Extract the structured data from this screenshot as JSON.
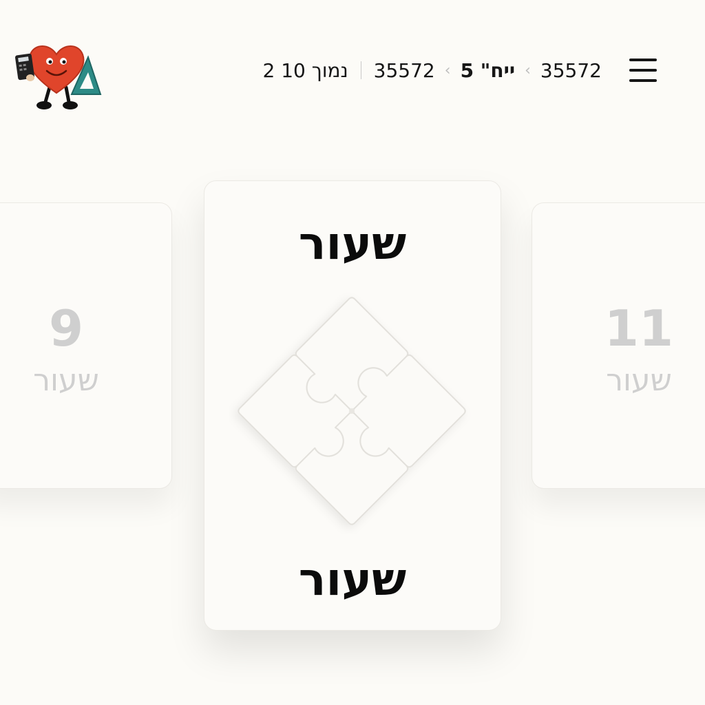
{
  "header": {
    "menu_icon": "hamburger-menu-icon",
    "mascot_icon": "heart-mascot-with-calculator-and-ruler",
    "breadcrumb": {
      "item1": "35572",
      "item2": "ייח\" 5",
      "item3": "35572",
      "item4": "נמוך 10 2"
    }
  },
  "cards": {
    "previous": {
      "number": "9",
      "word": "שעור"
    },
    "current": {
      "word_top": "שעור",
      "word_bottom": "שעור",
      "icon": "puzzle-pieces-icon"
    },
    "next": {
      "number": "11",
      "word": "שעור"
    }
  },
  "colors": {
    "background": "#fcfbf7",
    "card": "#fcfbf8",
    "muted_text": "#cfcfcf",
    "mascot_red": "#e0452b"
  }
}
